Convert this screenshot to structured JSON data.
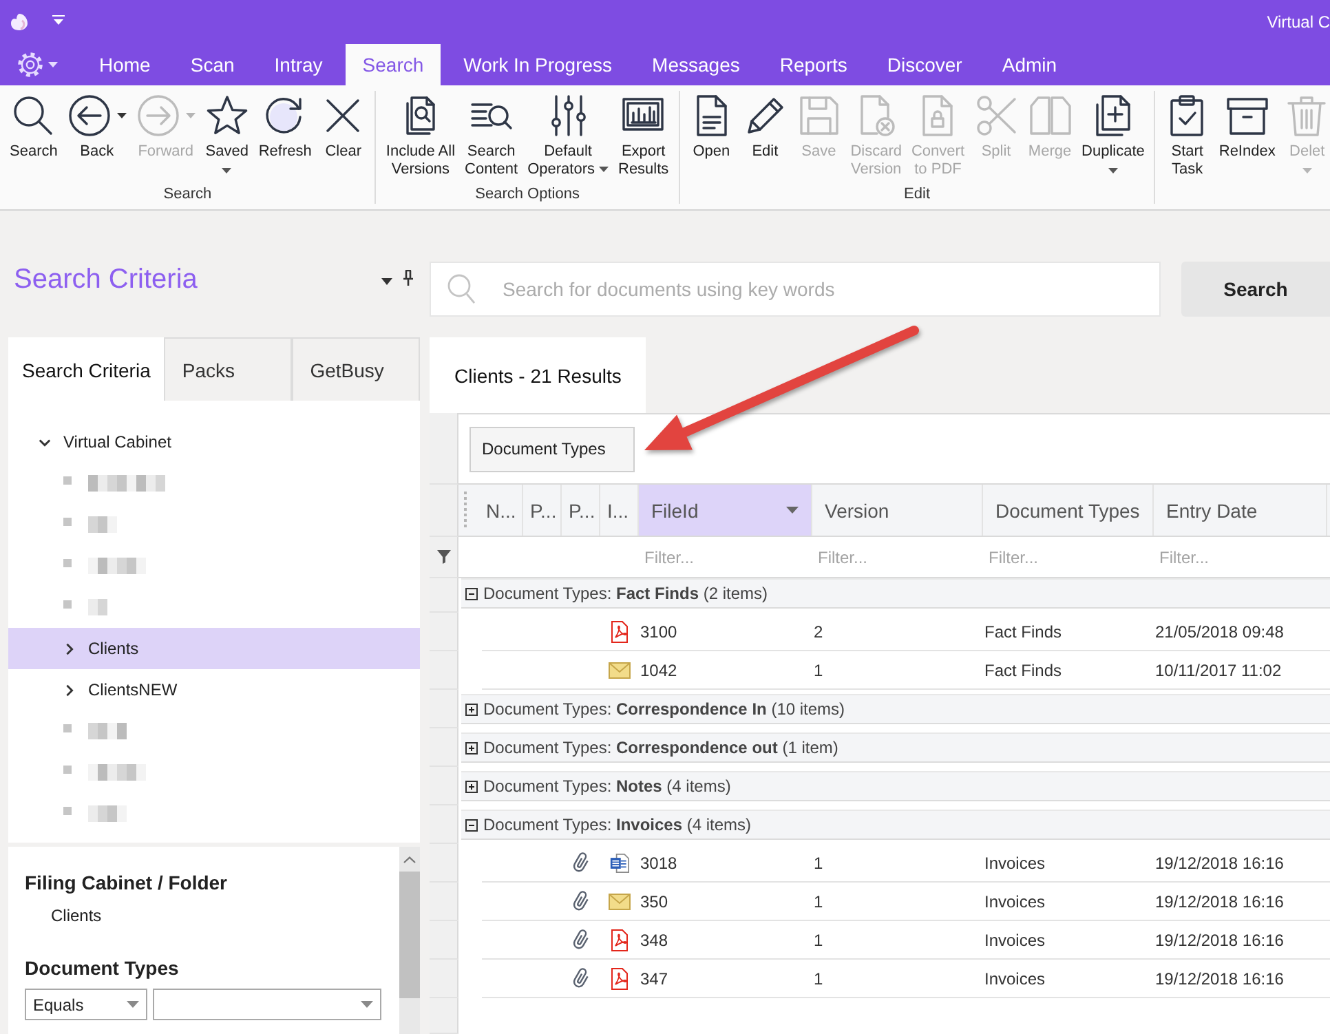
{
  "title_bar": {
    "title": "Virtual C"
  },
  "menu_tabs": [
    {
      "label": "Home",
      "selected": false
    },
    {
      "label": "Scan",
      "selected": false
    },
    {
      "label": "Intray",
      "selected": false
    },
    {
      "label": "Search",
      "selected": true
    },
    {
      "label": "Work In Progress",
      "selected": false
    },
    {
      "label": "Messages",
      "selected": false
    },
    {
      "label": "Reports",
      "selected": false
    },
    {
      "label": "Discover",
      "selected": false
    },
    {
      "label": "Admin",
      "selected": false
    }
  ],
  "ribbon": {
    "groups": [
      {
        "label": "Search",
        "buttons": [
          {
            "label": "Search",
            "kind": "plain",
            "disabled": false
          },
          {
            "label": "Back",
            "kind": "split",
            "disabled": false
          },
          {
            "label": "Forward",
            "kind": "split",
            "disabled": true
          },
          {
            "label": "Saved",
            "kind": "menu",
            "disabled": false
          },
          {
            "label": "Refresh",
            "kind": "plain",
            "disabled": false
          },
          {
            "label": "Clear",
            "kind": "plain",
            "disabled": false
          }
        ]
      },
      {
        "label": "Search Options",
        "buttons": [
          {
            "label": "Include All\nVersions",
            "kind": "plain",
            "disabled": false
          },
          {
            "label": "Search\nContent",
            "kind": "plain",
            "disabled": false
          },
          {
            "label": "Default\nOperators",
            "kind": "menu",
            "disabled": false
          },
          {
            "label": "Export\nResults",
            "kind": "plain",
            "disabled": false
          }
        ]
      },
      {
        "label": "Edit",
        "buttons": [
          {
            "label": "Open",
            "kind": "plain",
            "disabled": false
          },
          {
            "label": "Edit",
            "kind": "plain",
            "disabled": false
          },
          {
            "label": "Save",
            "kind": "plain",
            "disabled": true
          },
          {
            "label": "Discard\nVersion",
            "kind": "plain",
            "disabled": true
          },
          {
            "label": "Convert\nto PDF",
            "kind": "plain",
            "disabled": true
          },
          {
            "label": "Split",
            "kind": "plain",
            "disabled": true
          },
          {
            "label": "Merge",
            "kind": "plain",
            "disabled": true
          },
          {
            "label": "Duplicate",
            "kind": "menu",
            "disabled": false
          }
        ]
      },
      {
        "buttons": [
          {
            "label": "Start\nTask",
            "kind": "plain",
            "disabled": false
          },
          {
            "label": "ReIndex",
            "kind": "plain",
            "disabled": false
          },
          {
            "label": "Delet",
            "kind": "menu",
            "disabled": true
          }
        ]
      }
    ]
  },
  "search_panel": {
    "title": "Search Criteria"
  },
  "panel_tabs": [
    {
      "label": "Search Criteria",
      "selected": true
    },
    {
      "label": "Packs",
      "selected": false
    },
    {
      "label": "GetBusy",
      "selected": false
    }
  ],
  "tree": [
    {
      "label": "Virtual Cabinet",
      "kind": "folder",
      "expanded": true,
      "selected": false,
      "children": [
        {
          "kind": "redacted",
          "selected": false
        },
        {
          "kind": "redacted",
          "selected": false
        },
        {
          "kind": "redacted",
          "selected": false
        },
        {
          "kind": "redacted",
          "selected": false
        },
        {
          "label": "Clients",
          "kind": "folder",
          "expanded": false,
          "selected": true
        },
        {
          "label": "ClientsNEW",
          "kind": "folder",
          "expanded": false,
          "selected": false
        },
        {
          "kind": "redacted",
          "selected": false
        },
        {
          "kind": "redacted",
          "selected": false
        },
        {
          "kind": "redacted",
          "selected": false
        }
      ]
    }
  ],
  "criteria": [
    {
      "kind": "text",
      "heading": "Filing Cabinet / Folder",
      "value": "Clients"
    },
    {
      "kind": "combo",
      "heading": "Document Types",
      "operator": "Equals"
    }
  ],
  "search": {
    "placeholder": "Search for documents using key words",
    "button": "Search"
  },
  "result_tabs": [
    {
      "label": "Clients - 21 Results",
      "selected": true
    }
  ],
  "grid": {
    "group_panel": [
      "Document Types"
    ],
    "columns": [
      {
        "label": "N...",
        "selected": false
      },
      {
        "label": "P...",
        "selected": false
      },
      {
        "label": "P...",
        "selected": false
      },
      {
        "label": "I...",
        "selected": false
      },
      {
        "label": "FileId",
        "selected": true,
        "filter": {
          "placeholder": "Filter..."
        }
      },
      {
        "label": "Version",
        "selected": false,
        "filter": {
          "placeholder": "Filter..."
        }
      },
      {
        "label": "Document Types",
        "selected": false,
        "filter": {
          "placeholder": "Filter..."
        }
      },
      {
        "label": "Entry Date",
        "selected": false,
        "filter": {
          "placeholder": "Filter..."
        }
      }
    ],
    "groups": [
      {
        "label": "Document Types: **Fact Finds** (2 items)",
        "expanded": true,
        "rows": [
          {
            "kind": "pdf",
            "attachment": false,
            "cells": [
              "3100",
              "2",
              "Fact Finds",
              "21/05/2018 09:48"
            ]
          },
          {
            "kind": "mail",
            "attachment": false,
            "cells": [
              "1042",
              "1",
              "Fact Finds",
              "10/11/2017 11:02"
            ]
          }
        ]
      },
      {
        "label": "Document Types: **Correspondence In** (10 items)",
        "expanded": false
      },
      {
        "label": "Document Types: **Correspondence out** (1 item)",
        "expanded": false
      },
      {
        "label": "Document Types: **Notes** (4 items)",
        "expanded": false
      },
      {
        "label": "Document Types: **Invoices** (4 items)",
        "expanded": true,
        "rows": [
          {
            "kind": "word",
            "attachment": true,
            "cells": [
              "3018",
              "1",
              "Invoices",
              "19/12/2018 16:16"
            ]
          },
          {
            "kind": "mail",
            "attachment": true,
            "cells": [
              "350",
              "1",
              "Invoices",
              "19/12/2018 16:16"
            ]
          },
          {
            "kind": "pdf",
            "attachment": true,
            "cells": [
              "348",
              "1",
              "Invoices",
              "19/12/2018 16:16"
            ]
          },
          {
            "kind": "pdf",
            "attachment": true,
            "cells": [
              "347",
              "1",
              "Invoices",
              "19/12/2018 16:16"
            ]
          }
        ]
      }
    ]
  }
}
